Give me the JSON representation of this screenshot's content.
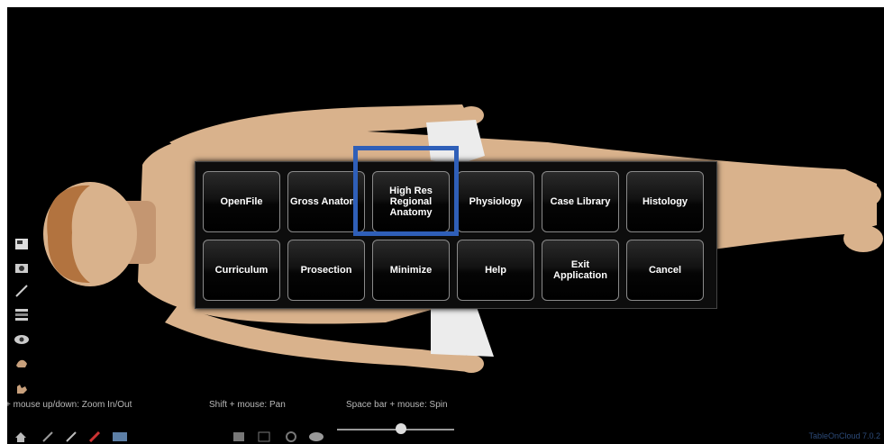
{
  "menu": {
    "row1": [
      "OpenFile",
      "Gross Anatom",
      "High Res\nRegional\nAnatomy",
      "Physiology",
      "Case Library",
      "Histology"
    ],
    "row2": [
      "Curriculum",
      "Prosection",
      "Minimize",
      "Help",
      "Exit\nApplication",
      "Cancel"
    ]
  },
  "hints": {
    "zoom": "+ mouse up/down: Zoom In/Out",
    "pan": "Shift + mouse: Pan",
    "spin": "Space bar + mouse: Spin"
  },
  "version": "TableOnCloud 7.0.2",
  "zoom_slider_fraction": 0.55,
  "colors": {
    "highlight": "#2f5fb8",
    "background": "#000000"
  }
}
